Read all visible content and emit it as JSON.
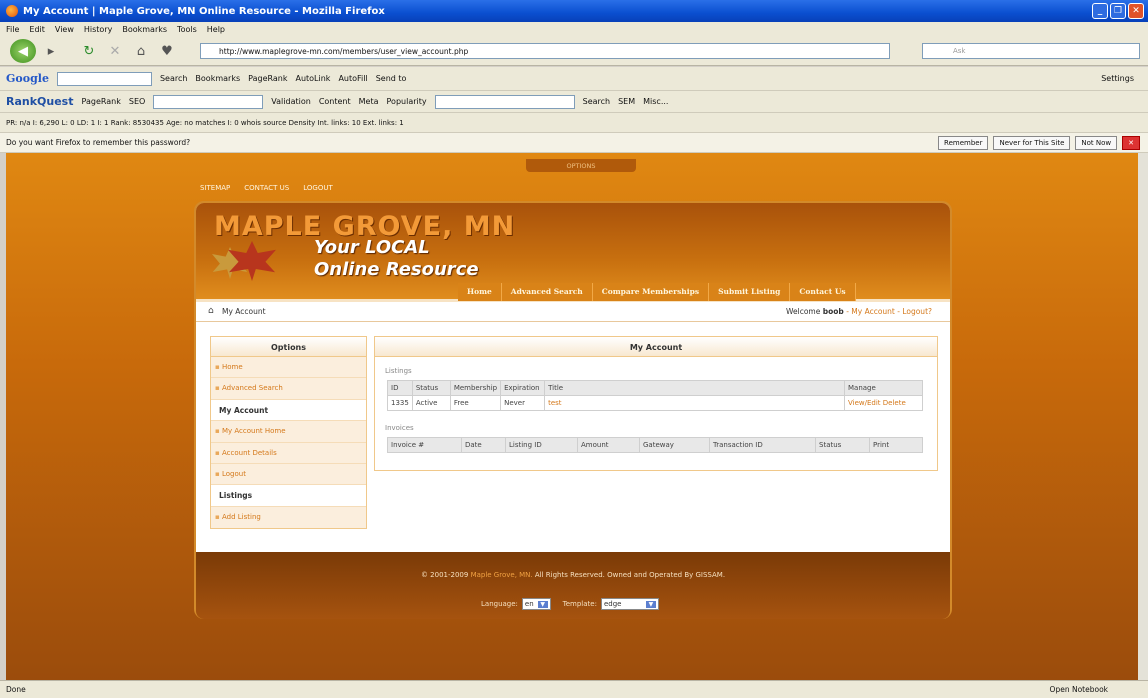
{
  "window": {
    "title": "My Account | Maple Grove, MN Online Resource - Mozilla Firefox"
  },
  "menu": [
    "File",
    "Edit",
    "View",
    "History",
    "Bookmarks",
    "Tools",
    "Help"
  ],
  "nav": {
    "url": "http://www.maplegrove-mn.com/members/user_view_account.php",
    "search_placeholder": "Ask"
  },
  "google_toolbar": {
    "logo": "Google",
    "items": [
      "Search",
      "Bookmarks",
      "PageRank",
      "AutoLink",
      "AutoFill",
      "Send to"
    ],
    "settings": "Settings"
  },
  "rankquest": {
    "logo": "RankQuest",
    "items": [
      "PageRank",
      "SEO",
      "Validation",
      "Content",
      "Meta",
      "Popularity",
      "Search",
      "SEM",
      "Misc..."
    ]
  },
  "seo_toolbar": "PR: n/a   I: 6,290   L: 0   LD: 1   I: 1   Rank: 8530435   Age: no matches   I: 0   whois   source   Density   Int. links: 10   Ext. links: 1",
  "password_bar": {
    "text": "Do you want Firefox to remember this password?",
    "remember": "Remember",
    "never": "Never for This Site",
    "not_now": "Not Now"
  },
  "site": {
    "options_tab": "OPTIONS",
    "top_links": [
      "SITEMAP",
      "CONTACT US",
      "LOGOUT"
    ],
    "title": "MAPLE GROVE, MN",
    "tagline1": "Your LOCAL",
    "tagline2": "Online Resource",
    "main_nav": [
      "Home",
      "Advanced Search",
      "Compare Memberships",
      "Submit Listing",
      "Contact Us"
    ],
    "breadcrumb": "My Account",
    "welcome_prefix": "Welcome",
    "username": "boob",
    "welcome_links": "- My Account - Logout?"
  },
  "sidebar": {
    "header": "Options",
    "items": [
      {
        "type": "link",
        "label": "Home"
      },
      {
        "type": "link",
        "label": "Advanced Search"
      },
      {
        "type": "section",
        "label": "My Account"
      },
      {
        "type": "link",
        "label": "My Account Home"
      },
      {
        "type": "link",
        "label": "Account Details"
      },
      {
        "type": "link",
        "label": "Logout"
      },
      {
        "type": "section",
        "label": "Listings"
      },
      {
        "type": "link",
        "label": "Add Listing"
      }
    ]
  },
  "account": {
    "header": "My Account",
    "listings_label": "Listings",
    "listings_columns": [
      "ID",
      "Status",
      "Membership",
      "Expiration",
      "Title",
      "Manage"
    ],
    "listings_rows": [
      [
        "1335",
        "Active",
        "Free",
        "Never",
        "test",
        "View/Edit Delete"
      ]
    ],
    "invoices_label": "Invoices",
    "invoices_columns": [
      "Invoice #",
      "Date",
      "Listing ID",
      "Amount",
      "Gateway",
      "Transaction ID",
      "Status",
      "Print"
    ]
  },
  "footer": {
    "copyright_prefix": "© 2001-2009",
    "copyright_site": "Maple Grove, MN.",
    "copyright_suffix": "All Rights Reserved. Owned and Operated By GISSAM.",
    "language_label": "Language:",
    "language_value": "en",
    "template_label": "Template:",
    "template_value": "edge"
  },
  "status": {
    "left": "Done",
    "right": "Open Notebook"
  }
}
